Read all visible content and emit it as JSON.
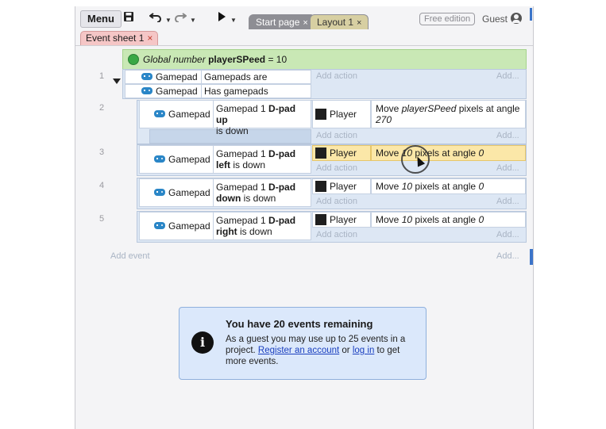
{
  "toolbar": {
    "menu_label": "Menu",
    "save_icon": "save-icon",
    "undo_icon": "undo-icon",
    "redo_icon": "redo-icon",
    "play_icon": "play-icon",
    "tabs": [
      {
        "label": "Start page",
        "close": "×"
      },
      {
        "label": "Layout 1",
        "close": "×"
      }
    ],
    "free_edition": "Free edition",
    "guest": "Guest"
  },
  "sheet_tab": {
    "label": "Event sheet 1",
    "close": "×"
  },
  "global": {
    "prefix": "Global number",
    "name": "playerSPeed",
    "value": "= 10"
  },
  "events": [
    {
      "num": "1",
      "conditions": [
        {
          "object": "Gamepad",
          "text": "Gamepads are supported"
        },
        {
          "object": "Gamepad",
          "text": "Has gamepads"
        }
      ],
      "add_action": "Add action",
      "add_right": "Add..."
    },
    {
      "num": "2",
      "object": "Gamepad",
      "cond_pre": "Gamepad 1 ",
      "cond_bold": "D-pad up",
      "cond_post": "is down",
      "action_object": "Player",
      "action_text_pre": "Move ",
      "action_var": "playerSPeed",
      "action_text_mid": " pixels at angle",
      "action_angle": "270",
      "add_action": "Add action",
      "add_right": "Add..."
    },
    {
      "num": "3",
      "object": "Gamepad",
      "cond_pre": "Gamepad 1 ",
      "cond_bold1": "D-pad",
      "cond_bold2": "left",
      "cond_post": " is down",
      "action_object": "Player",
      "action_text": "Move ",
      "action_num": "10",
      "action_rest": " pixels at angle ",
      "action_angle": "0",
      "add_action": "Add action",
      "add_right": "Add..."
    },
    {
      "num": "4",
      "object": "Gamepad",
      "cond_pre": "Gamepad 1 ",
      "cond_bold1": "D-pad",
      "cond_bold2": "down",
      "cond_post": " is down",
      "action_object": "Player",
      "action_text": "Move ",
      "action_num": "10",
      "action_rest": " pixels at angle ",
      "action_angle": "0",
      "add_action": "Add action",
      "add_right": "Add..."
    },
    {
      "num": "5",
      "object": "Gamepad",
      "cond_pre": "Gamepad 1 ",
      "cond_bold1": "D-pad",
      "cond_bold2": "right",
      "cond_post": " is down",
      "action_object": "Player",
      "action_text": "Move ",
      "action_num": "10",
      "action_rest": " pixels at angle ",
      "action_angle": "0",
      "add_action": "Add action",
      "add_right": "Add..."
    }
  ],
  "add_event": "Add event",
  "add_event_right": "Add...",
  "info": {
    "icon": "info-icon",
    "title": "You have 20 events remaining",
    "body_pre": "As a guest you may use up to 25 events in a project. ",
    "link1": "Register an account",
    "body_mid": " or ",
    "link2": "log in",
    "body_post": " to get more events."
  }
}
